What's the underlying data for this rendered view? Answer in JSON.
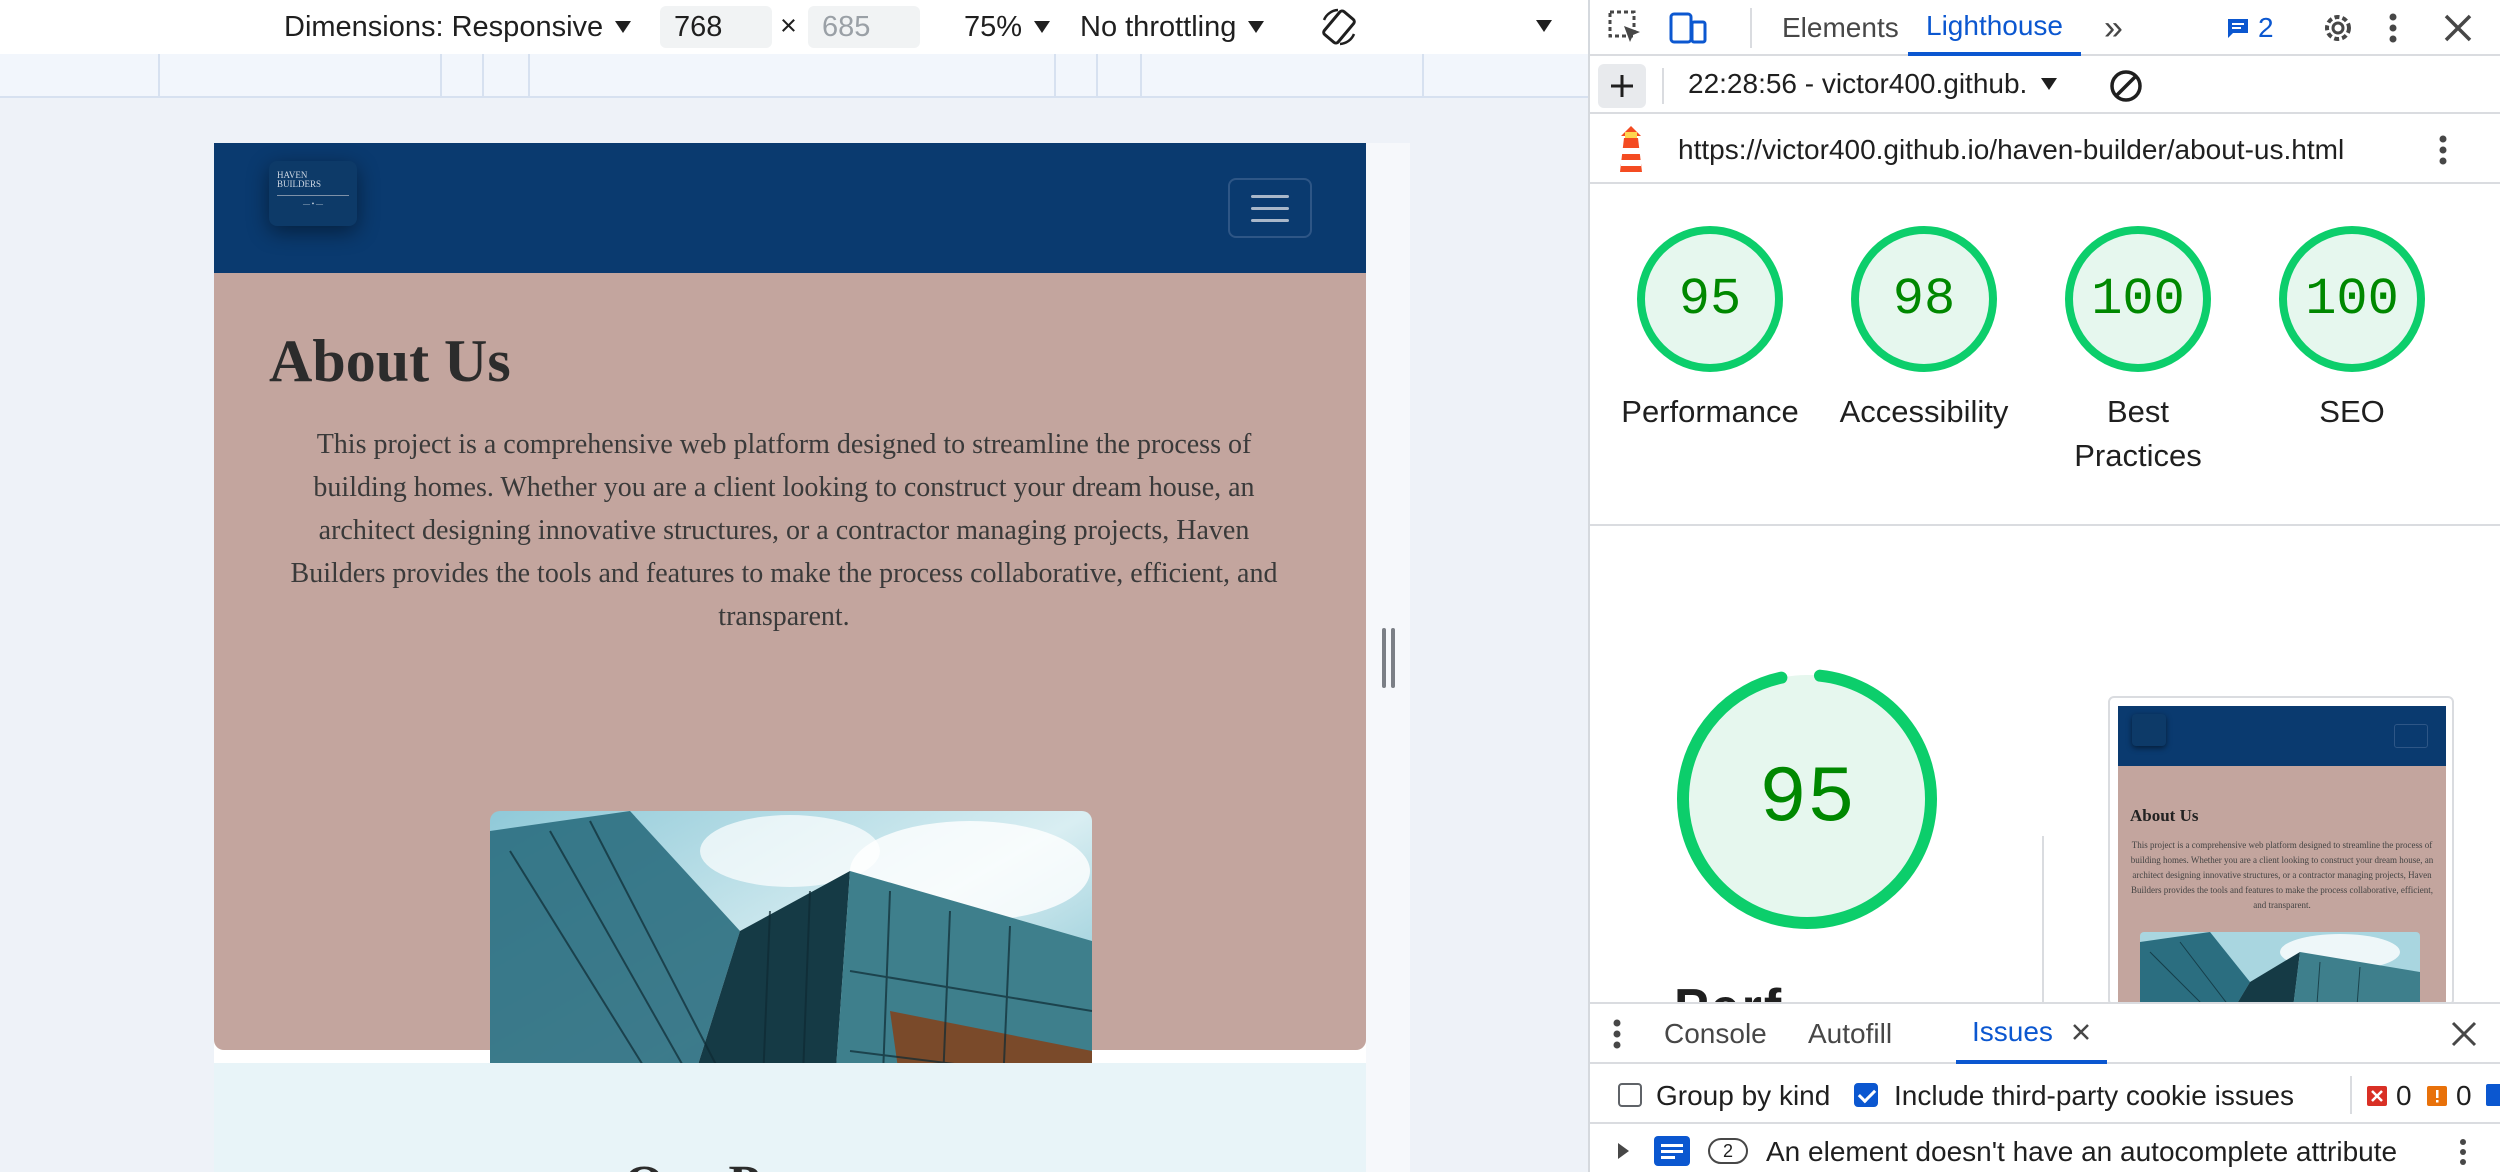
{
  "emulation": {
    "dimensions_label": "Dimensions: Responsive",
    "width": "768",
    "height_placeholder": "685",
    "times": "×",
    "zoom": "75%",
    "throttling": "No throttling"
  },
  "site": {
    "logo_line1": "HAVEN",
    "logo_line2": "BUILDERS",
    "about_title": "About Us",
    "about_text": "This project is a comprehensive web platform designed to streamline the process of building homes. Whether you are a client looking to construct your dream house, an architect designing innovative structures, or a contractor managing projects, Haven Builders provides the tools and features to make the process collaborative, efficient, and transparent.",
    "next_heading": "Our P"
  },
  "devtools": {
    "tabs": [
      "Elements",
      "Lighthouse"
    ],
    "more_tabs": "»",
    "messages_count": "2",
    "report_selector": "22:28:56 - victor400.github.",
    "url": "https://victor400.github.io/haven-builder/about-us.html",
    "scores": [
      {
        "value": 95,
        "label": "Performance"
      },
      {
        "value": 98,
        "label": "Accessibility"
      },
      {
        "value": 100,
        "label": "Best Practices"
      },
      {
        "value": 100,
        "label": "SEO"
      }
    ],
    "performance_score": "95",
    "performance_heading_cut": "Perf",
    "thumb_title": "About Us",
    "thumb_text": "This project is a comprehensive web platform designed to streamline the process of building homes. Whether you are a client looking to construct your dream house, an architect designing innovative structures, or a contractor managing projects, Haven Builders provides the tools and features to make the process collaborative, efficient, and transparent.",
    "score_color": "#0cce6b"
  },
  "drawer": {
    "tabs": [
      "Console",
      "Autofill",
      "Issues"
    ],
    "group_by_kind": "Group by kind",
    "include_third_party": "Include third-party cookie issues",
    "errors_count": "0",
    "warnings_count": "0",
    "issue_count": "2",
    "issue_text": "An element doesn't have an autocomplete attribute"
  }
}
